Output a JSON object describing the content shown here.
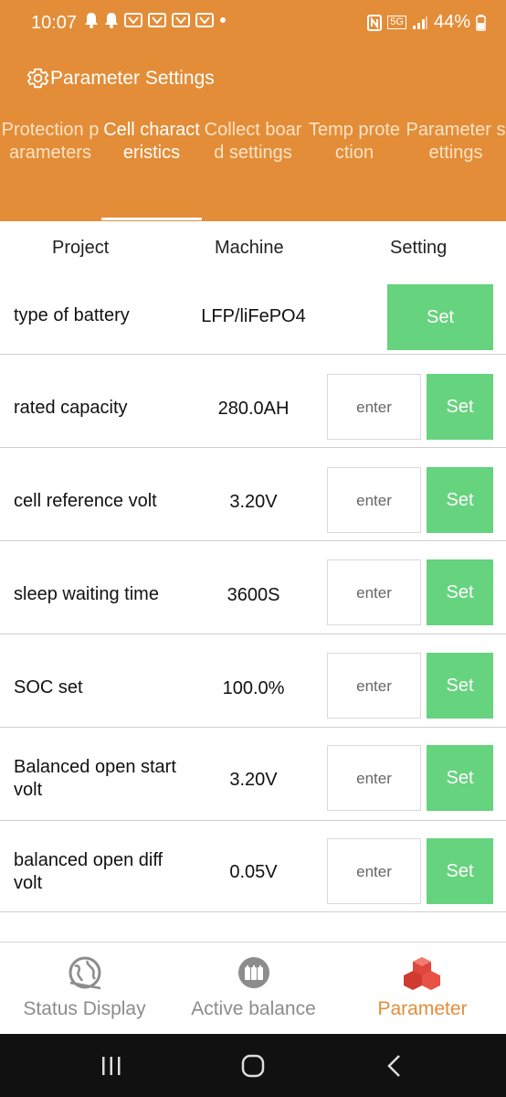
{
  "status_bar": {
    "time": "10:07",
    "battery_percent": "44%",
    "signal": "5G"
  },
  "header": {
    "title": "Parameter Settings",
    "settings_icon": "gear-icon"
  },
  "tabs": [
    {
      "label": "Protection parameters",
      "active": false
    },
    {
      "label": "Cell characteristics",
      "active": true
    },
    {
      "label": "Collect board settings",
      "active": false
    },
    {
      "label": "Temp protection",
      "active": false
    },
    {
      "label": "Parameter settings",
      "active": false
    }
  ],
  "columns": {
    "project": "Project",
    "machine": "Machine",
    "setting": "Setting"
  },
  "rows": [
    {
      "label": "type of battery",
      "value": "LFP/liFePO4",
      "enter": "",
      "set": "Set"
    },
    {
      "label": "rated capacity",
      "value": "280.0AH",
      "enter": "enter",
      "set": "Set"
    },
    {
      "label": "cell reference volt",
      "value": "3.20V",
      "enter": "enter",
      "set": "Set"
    },
    {
      "label": "sleep waiting time",
      "value": "3600S",
      "enter": "enter",
      "set": "Set"
    },
    {
      "label": "SOC set",
      "value": "100.0%",
      "enter": "enter",
      "set": "Set"
    },
    {
      "label": "Balanced open start volt",
      "value": "3.20V",
      "enter": "enter",
      "set": "Set"
    },
    {
      "label": "balanced open diff volt",
      "value": "0.05V",
      "enter": "enter",
      "set": "Set"
    }
  ],
  "bottom_nav": [
    {
      "label": "Status Display",
      "icon": "globe-icon",
      "active": false
    },
    {
      "label": "Active balance",
      "icon": "balance-icon",
      "active": false
    },
    {
      "label": "Parameter",
      "icon": "cubes-icon",
      "active": true
    }
  ],
  "colors": {
    "accent": "#e38d38",
    "set_button": "#66d37e",
    "tab_inactive": "#fbe3c6"
  }
}
